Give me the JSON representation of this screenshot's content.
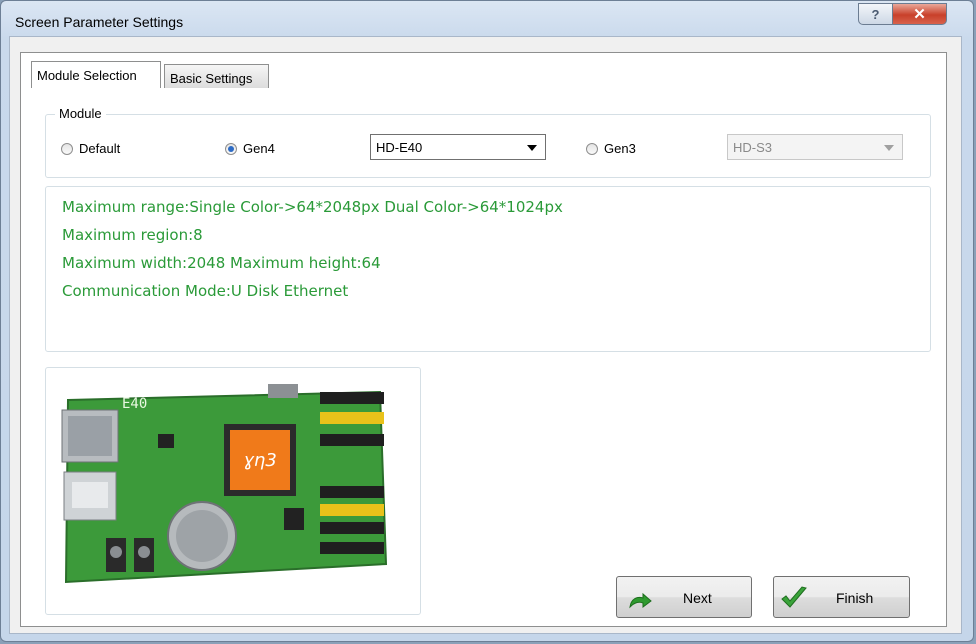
{
  "window": {
    "title": "Screen Parameter Settings",
    "help_glyph": "?",
    "close_glyph": "✕"
  },
  "tabs": [
    {
      "label": "Module Selection",
      "active": true
    },
    {
      "label": "Basic Settings",
      "active": false
    }
  ],
  "module_group": {
    "label": "Module",
    "options": [
      {
        "label": "Default",
        "selected": false
      },
      {
        "label": "Gen4",
        "selected": true
      },
      {
        "label": "Gen3",
        "selected": false
      }
    ],
    "gen4_select": {
      "value": "HD-E40",
      "enabled": true
    },
    "gen3_select": {
      "value": "HD-S3",
      "enabled": false
    }
  },
  "info_lines": [
    "Maximum range:Single Color->64*2048px  Dual Color->64*1024px",
    "Maximum region:8",
    "Maximum width:2048 Maximum height:64",
    "Communication Mode:U Disk  Ethernet"
  ],
  "board_image": {
    "silkscreen": "E40",
    "chip_logo": "ɣη3"
  },
  "buttons": {
    "next": "Next",
    "finish": "Finish"
  },
  "colors": {
    "info_text": "#2a9a38",
    "board_green": "#3c9a3a",
    "chip_orange": "#f07a1a"
  }
}
